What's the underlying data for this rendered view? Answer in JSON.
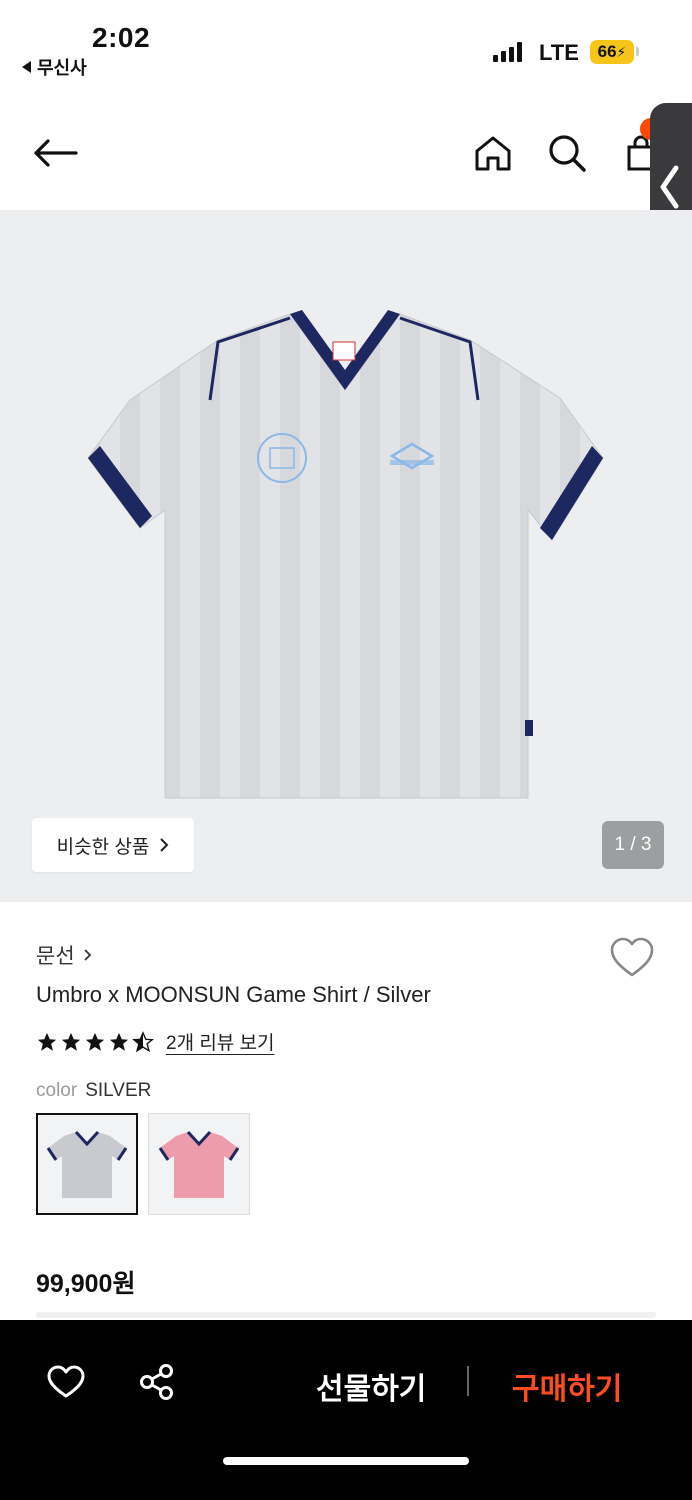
{
  "status_bar": {
    "time": "2:02",
    "back_app": "무신사",
    "network": "LTE",
    "battery": "66"
  },
  "nav": {
    "icons": [
      "back-arrow-icon",
      "home-icon",
      "search-icon",
      "shopping-bag-icon"
    ]
  },
  "gallery": {
    "similar_button": "비슷한 상품",
    "page_indicator": "1 / 3"
  },
  "product": {
    "brand": "문선",
    "title": "Umbro x MOONSUN Game Shirt / Silver",
    "rating": 4.5,
    "review_link": "2개 리뷰 보기",
    "color_label": "color",
    "color_value": "SILVER",
    "swatches": [
      {
        "name": "silver",
        "color": "#c9cacf",
        "selected": true
      },
      {
        "name": "pink",
        "color": "#ec9cab",
        "selected": false
      }
    ],
    "price": "99,900원"
  },
  "bottom_bar": {
    "gift_label": "선물하기",
    "buy_label": "구매하기",
    "accent_color": "#ff4d1f"
  },
  "colors": {
    "shirt_body": "#dcdde1",
    "shirt_trim": "#1d2760",
    "logo_blue": "#8ab8e8"
  }
}
